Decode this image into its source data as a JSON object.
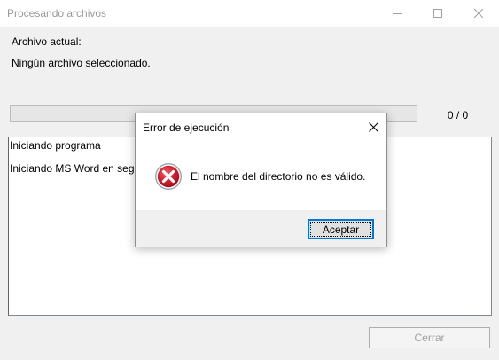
{
  "window": {
    "title": "Procesando archivos",
    "minimize_icon": "minimize-icon",
    "maximize_icon": "maximize-icon",
    "close_icon": "close-icon"
  },
  "current_file": {
    "label": "Archivo actual:",
    "value": "Ningún archivo seleccionado."
  },
  "progress": {
    "fraction": 0,
    "counter": "0  /  0"
  },
  "log": {
    "lines": [
      "Iniciando programa",
      "Iniciando MS Word en segundo plano..."
    ]
  },
  "footer": {
    "close_label": "Cerrar"
  },
  "dialog": {
    "title": "Error de ejecución",
    "message": "El nombre del directorio no es válido.",
    "ok_label": "Aceptar",
    "icon": "error-icon",
    "accent": "#0078d7"
  }
}
